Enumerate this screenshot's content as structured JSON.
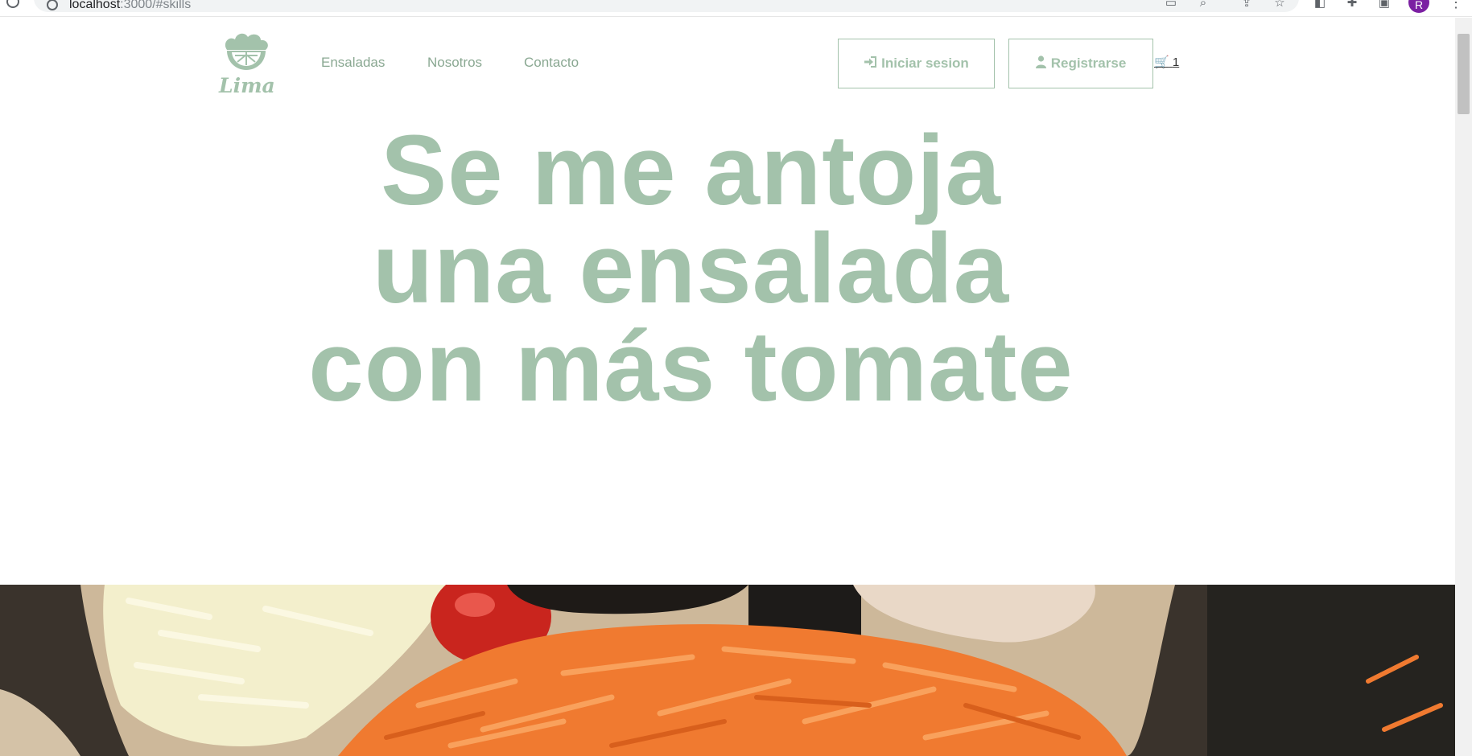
{
  "browser": {
    "url_host": "localhost",
    "url_rest": ":3000/#skills",
    "profile_initial": "R"
  },
  "brand": {
    "logo_text": "Lima",
    "accent_color": "#a3c2ab"
  },
  "nav": {
    "items": [
      {
        "label": "Ensaladas"
      },
      {
        "label": "Nosotros"
      },
      {
        "label": "Contacto"
      }
    ]
  },
  "auth": {
    "login_label": "Iniciar sesion",
    "register_label": "Registrarse"
  },
  "cart": {
    "count": "1",
    "icon": "cart-icon"
  },
  "hero": {
    "lines": [
      "Se me antoja",
      "una ensalada",
      "con más tomate"
    ]
  },
  "banner": {
    "image": "salad-bowl-photo"
  }
}
